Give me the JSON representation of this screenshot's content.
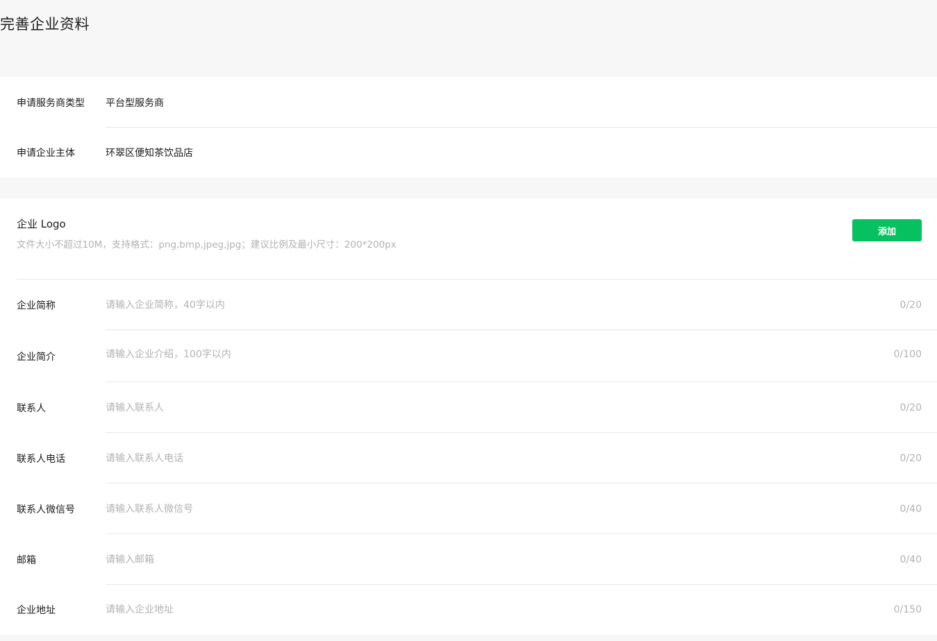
{
  "header": {
    "title": "完善企业资料"
  },
  "info": {
    "provider_type_label": "申请服务商类型",
    "provider_type_value": "平台型服务商",
    "entity_label": "申请企业主体",
    "entity_value": "环翠区便知茶饮品店"
  },
  "logo": {
    "title": "企业 Logo",
    "hint": "文件大小不超过10M，支持格式：png,bmp,jpeg,jpg；建议比例及最小尺寸：200*200px",
    "add_label": "添加"
  },
  "fields": [
    {
      "label": "企业简称",
      "placeholder": "请输入企业简称，40字以内",
      "counter": "0/20"
    },
    {
      "label": "企业简介",
      "placeholder": "请输入企业介绍，100字以内",
      "counter": "0/100"
    },
    {
      "label": "联系人",
      "placeholder": "请输入联系人",
      "counter": "0/20"
    },
    {
      "label": "联系人电话",
      "placeholder": "请输入联系人电话",
      "counter": "0/20"
    },
    {
      "label": "联系人微信号",
      "placeholder": "请输入联系人微信号",
      "counter": "0/40"
    },
    {
      "label": "邮箱",
      "placeholder": "请输入邮箱",
      "counter": "0/40"
    },
    {
      "label": "企业地址",
      "placeholder": "请输入企业地址",
      "counter": "0/150"
    }
  ],
  "colors": {
    "accent": "#07c160",
    "background": "#f7f7f7",
    "placeholder": "#b2b2b2"
  }
}
